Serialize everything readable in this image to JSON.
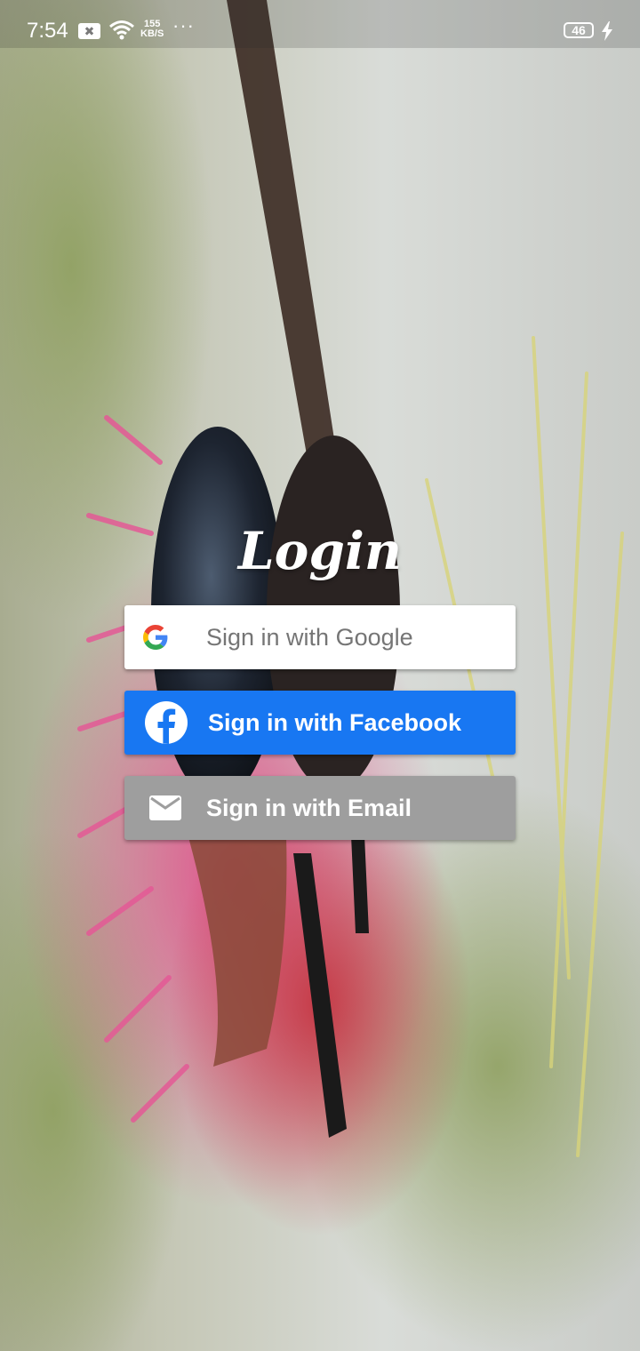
{
  "status_bar": {
    "time": "7:54",
    "notification_glyph": "✖",
    "net_speed_value": "155",
    "net_speed_unit": "KB/S",
    "overflow_dots": "···",
    "battery_level": "46",
    "icons": [
      "notification-icon",
      "wifi-icon",
      "charging-icon"
    ]
  },
  "login": {
    "title": "Login",
    "buttons": {
      "google": {
        "label": "Sign in with Google",
        "icon": "google-icon",
        "color": "#ffffff"
      },
      "facebook": {
        "label": "Sign in with Facebook",
        "icon": "facebook-icon",
        "color": "#1877f2"
      },
      "email": {
        "label": "Sign in with Email",
        "icon": "mail-icon",
        "color": "#9e9e9e"
      }
    }
  },
  "background": {
    "icon": "insect-on-flower-photo"
  }
}
